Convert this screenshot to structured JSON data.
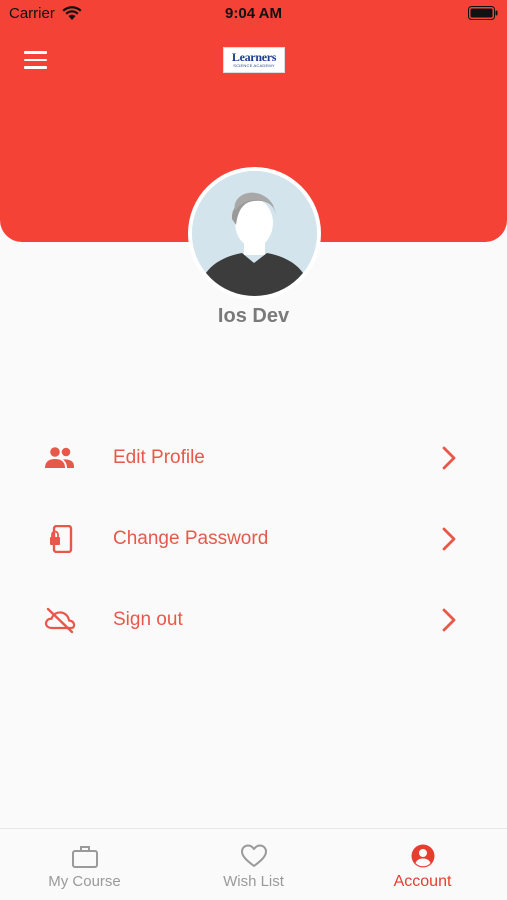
{
  "status_bar": {
    "carrier": "Carrier",
    "time": "9:04 AM"
  },
  "header": {
    "logo_main": "Learners",
    "logo_sub": "SCIENCE ACADEMY",
    "background_color": "#f44236"
  },
  "profile": {
    "name": "Ios Dev"
  },
  "menu": {
    "items": [
      {
        "label": "Edit Profile",
        "icon": "people-icon"
      },
      {
        "label": "Change Password",
        "icon": "phone-lock-icon"
      },
      {
        "label": "Sign out",
        "icon": "cloud-off-icon"
      }
    ],
    "accent_color": "#e8584a"
  },
  "tabbar": {
    "tabs": [
      {
        "label": "My Course",
        "icon": "briefcase-icon",
        "active": false
      },
      {
        "label": "Wish List",
        "icon": "heart-icon",
        "active": false
      },
      {
        "label": "Account",
        "icon": "account-circle-icon",
        "active": true
      }
    ]
  }
}
